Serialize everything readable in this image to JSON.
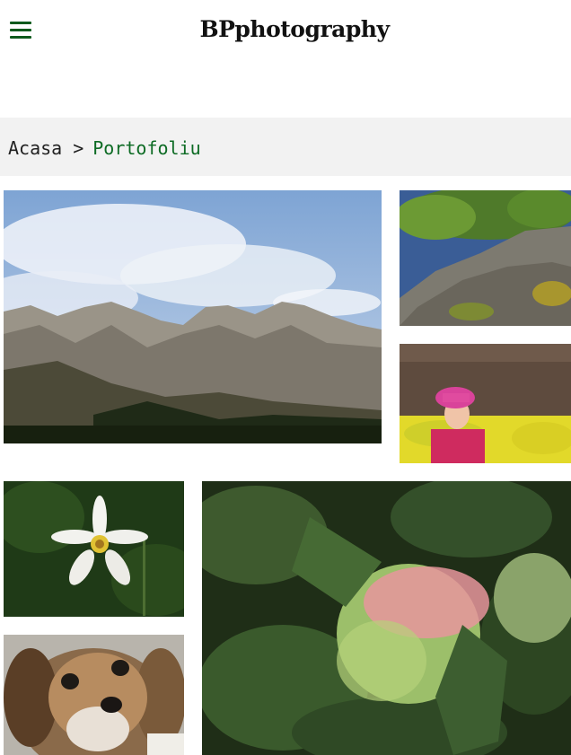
{
  "header": {
    "menu_icon": "hamburger-menu-icon",
    "logo": "BPphotography"
  },
  "breadcrumb": {
    "home": "Acasa",
    "separator": ">",
    "current": "Portofoliu"
  },
  "gallery": {
    "photos": [
      {
        "subject": "mountains"
      },
      {
        "subject": "tree-trunk"
      },
      {
        "subject": "girl-in-field"
      },
      {
        "subject": "white-flower"
      },
      {
        "subject": "apple"
      },
      {
        "subject": "dog"
      }
    ]
  },
  "colors": {
    "accent": "#0d6b24",
    "breadcrumb_bg": "#f2f2f2"
  }
}
